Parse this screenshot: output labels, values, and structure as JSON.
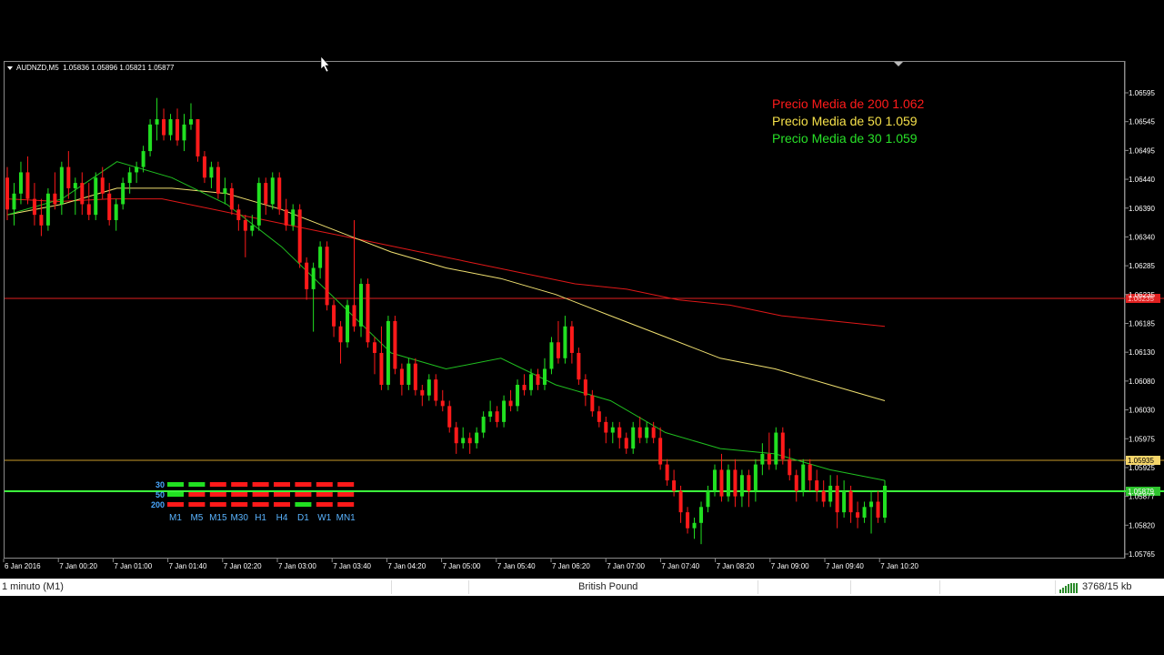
{
  "chart_header": {
    "symbol_timeframe": "AUDNZD,M5",
    "ohlc": "1.05836 1.05896 1.05821 1.05877"
  },
  "legend": {
    "ma200": "Precio Media de 200  1.062",
    "ma50": "Precio Media de 50  1.059",
    "ma30": "Precio Media de 30  1.059"
  },
  "price_axis": {
    "ticks": [
      "1.06595",
      "1.06545",
      "1.06495",
      "1.06440",
      "1.06390",
      "1.06340",
      "1.06285",
      "1.06235",
      "1.06185",
      "1.06130",
      "1.06080",
      "1.06030",
      "1.05975",
      "1.05925",
      "1.05877",
      "1.05820",
      "1.05765"
    ],
    "markers": {
      "red_line": "1.06235",
      "orange_line": "1.05935",
      "green_line": "1.05879"
    }
  },
  "time_axis": {
    "ticks": [
      "6 Jan 2016",
      "7 Jan 00:20",
      "7 Jan 01:00",
      "7 Jan 01:40",
      "7 Jan 02:20",
      "7 Jan 03:00",
      "7 Jan 03:40",
      "7 Jan 04:20",
      "7 Jan 05:00",
      "7 Jan 05:40",
      "7 Jan 06:20",
      "7 Jan 07:00",
      "7 Jan 07:40",
      "7 Jan 08:20",
      "7 Jan 09:00",
      "7 Jan 09:40",
      "7 Jan 10:20"
    ]
  },
  "mtf_indicator": {
    "rows": [
      {
        "label": "30",
        "states": [
          "up",
          "up",
          "down",
          "down",
          "down",
          "down",
          "down",
          "down",
          "down"
        ]
      },
      {
        "label": "50",
        "states": [
          "up",
          "down",
          "down",
          "down",
          "down",
          "down",
          "down",
          "down",
          "down"
        ]
      },
      {
        "label": "200",
        "states": [
          "down",
          "down",
          "down",
          "down",
          "down",
          "down",
          "up",
          "down",
          "down"
        ]
      }
    ],
    "timeframes": [
      "M1",
      "M5",
      "M15",
      "M30",
      "H1",
      "H4",
      "D1",
      "W1",
      "MN1"
    ]
  },
  "status_bar": {
    "timeframe": "1 minuto (M1)",
    "profile": "British Pound",
    "traffic": "3768/15 kb"
  },
  "colors": {
    "bull": "#21e021",
    "bear": "#ff1a1a",
    "ma200": "#e01818",
    "ma50": "#f0e070",
    "ma30": "#20c020",
    "price_line": "#3cff3c",
    "level_red": "#e02020",
    "level_orange": "#c89a2a"
  },
  "chart_data": {
    "type": "candlestick",
    "symbol": "AUDNZD",
    "timeframe": "M5",
    "ylim": [
      1.0575,
      1.0662
    ],
    "candles": [
      [
        1.0645,
        1.0647,
        1.0637,
        1.0639
      ],
      [
        1.0639,
        1.0644,
        1.0636,
        1.0642
      ],
      [
        1.0642,
        1.0648,
        1.064,
        1.0646
      ],
      [
        1.0646,
        1.0649,
        1.064,
        1.0641
      ],
      [
        1.0641,
        1.0644,
        1.0636,
        1.0638
      ],
      [
        1.0638,
        1.0641,
        1.0634,
        1.0636
      ],
      [
        1.0636,
        1.0643,
        1.0635,
        1.0642
      ],
      [
        1.0642,
        1.0646,
        1.0639,
        1.064
      ],
      [
        1.064,
        1.0648,
        1.0638,
        1.0647
      ],
      [
        1.0647,
        1.065,
        1.0641,
        1.0643
      ],
      [
        1.0643,
        1.0645,
        1.0638,
        1.0644
      ],
      [
        1.0644,
        1.0646,
        1.0638,
        1.064
      ],
      [
        1.064,
        1.0644,
        1.0637,
        1.0638
      ],
      [
        1.0638,
        1.0646,
        1.0637,
        1.0645
      ],
      [
        1.0645,
        1.0647,
        1.0641,
        1.0642
      ],
      [
        1.0642,
        1.0644,
        1.0636,
        1.0637
      ],
      [
        1.0637,
        1.0641,
        1.0635,
        1.064
      ],
      [
        1.064,
        1.0645,
        1.0639,
        1.0644
      ],
      [
        1.0644,
        1.0647,
        1.0642,
        1.0646
      ],
      [
        1.0646,
        1.0648,
        1.0644,
        1.0647
      ],
      [
        1.0647,
        1.0651,
        1.0646,
        1.065
      ],
      [
        1.065,
        1.0656,
        1.0649,
        1.0655
      ],
      [
        1.0655,
        1.066,
        1.0652,
        1.0656
      ],
      [
        1.0656,
        1.0658,
        1.0652,
        1.0653
      ],
      [
        1.0653,
        1.0657,
        1.0652,
        1.0656
      ],
      [
        1.0656,
        1.0658,
        1.0651,
        1.0652
      ],
      [
        1.0652,
        1.0657,
        1.065,
        1.0655
      ],
      [
        1.0655,
        1.0659,
        1.0654,
        1.0656
      ],
      [
        1.0656,
        1.0656,
        1.0648,
        1.0649
      ],
      [
        1.0649,
        1.065,
        1.0644,
        1.0645
      ],
      [
        1.0645,
        1.0648,
        1.0643,
        1.0647
      ],
      [
        1.0647,
        1.0648,
        1.0641,
        1.0642
      ],
      [
        1.0642,
        1.0645,
        1.064,
        1.0643
      ],
      [
        1.0643,
        1.0644,
        1.0638,
        1.0639
      ],
      [
        1.0639,
        1.064,
        1.0635,
        1.0637
      ],
      [
        1.0637,
        1.0638,
        1.063,
        1.0635
      ],
      [
        1.0635,
        1.0638,
        1.0634,
        1.0636
      ],
      [
        1.0636,
        1.0645,
        1.0635,
        1.0644
      ],
      [
        1.0644,
        1.0645,
        1.0638,
        1.064
      ],
      [
        1.064,
        1.0646,
        1.0639,
        1.0645
      ],
      [
        1.0645,
        1.0646,
        1.0638,
        1.0639
      ],
      [
        1.0639,
        1.0641,
        1.0635,
        1.0636
      ],
      [
        1.0636,
        1.064,
        1.0635,
        1.0639
      ],
      [
        1.0639,
        1.064,
        1.0628,
        1.0629
      ],
      [
        1.0629,
        1.063,
        1.0622,
        1.0624
      ],
      [
        1.0624,
        1.0629,
        1.0616,
        1.0628
      ],
      [
        1.0628,
        1.0633,
        1.0626,
        1.0632
      ],
      [
        1.0632,
        1.0633,
        1.062,
        1.0621
      ],
      [
        1.0621,
        1.0622,
        1.0615,
        1.0617
      ],
      [
        1.0617,
        1.0618,
        1.061,
        1.0614
      ],
      [
        1.0614,
        1.0622,
        1.0613,
        1.0621
      ],
      [
        1.0621,
        1.0637,
        1.0616,
        1.0617
      ],
      [
        1.0617,
        1.0626,
        1.0615,
        1.0625
      ],
      [
        1.0625,
        1.0626,
        1.0613,
        1.0614
      ],
      [
        1.0614,
        1.0615,
        1.0608,
        1.0612
      ],
      [
        1.0612,
        1.0617,
        1.0605,
        1.0606
      ],
      [
        1.0606,
        1.0619,
        1.0605,
        1.0618
      ],
      [
        1.0618,
        1.0619,
        1.0608,
        1.0609
      ],
      [
        1.0609,
        1.061,
        1.0604,
        1.0606
      ],
      [
        1.0606,
        1.0611,
        1.0605,
        1.061
      ],
      [
        1.061,
        1.0611,
        1.0604,
        1.0605
      ],
      [
        1.0605,
        1.0606,
        1.0602,
        1.0604
      ],
      [
        1.0604,
        1.0608,
        1.0603,
        1.0607
      ],
      [
        1.0607,
        1.0608,
        1.0602,
        1.0603
      ],
      [
        1.0603,
        1.0605,
        1.0601,
        1.0602
      ],
      [
        1.0602,
        1.0603,
        1.0597,
        1.0598
      ],
      [
        1.0598,
        1.0599,
        1.0593,
        1.0595
      ],
      [
        1.0595,
        1.0598,
        1.0594,
        1.0596
      ],
      [
        1.0596,
        1.0597,
        1.0593,
        1.0595
      ],
      [
        1.0595,
        1.0598,
        1.0594,
        1.0597
      ],
      [
        1.0597,
        1.0601,
        1.0596,
        1.06
      ],
      [
        1.06,
        1.0603,
        1.0599,
        1.0601
      ],
      [
        1.0601,
        1.0602,
        1.0598,
        1.0599
      ],
      [
        1.0599,
        1.0604,
        1.0598,
        1.0603
      ],
      [
        1.0603,
        1.0605,
        1.0601,
        1.0602
      ],
      [
        1.0602,
        1.0607,
        1.0601,
        1.0606
      ],
      [
        1.0606,
        1.0608,
        1.0604,
        1.0605
      ],
      [
        1.0605,
        1.0609,
        1.0604,
        1.0608
      ],
      [
        1.0608,
        1.0609,
        1.0605,
        1.0606
      ],
      [
        1.0606,
        1.0611,
        1.0605,
        1.0609
      ],
      [
        1.0609,
        1.0615,
        1.0608,
        1.0614
      ],
      [
        1.0614,
        1.0618,
        1.061,
        1.0611
      ],
      [
        1.0611,
        1.0619,
        1.061,
        1.0617
      ],
      [
        1.0617,
        1.0618,
        1.061,
        1.0612
      ],
      [
        1.0612,
        1.0613,
        1.0606,
        1.0607
      ],
      [
        1.0607,
        1.0608,
        1.0602,
        1.0604
      ],
      [
        1.0604,
        1.0605,
        1.06,
        1.0601
      ],
      [
        1.0601,
        1.0602,
        1.0598,
        1.0599
      ],
      [
        1.0599,
        1.06,
        1.0595,
        1.0597
      ],
      [
        1.0597,
        1.0599,
        1.0595,
        1.0598
      ],
      [
        1.0598,
        1.0599,
        1.0594,
        1.0596
      ],
      [
        1.0596,
        1.0597,
        1.0593,
        1.0594
      ],
      [
        1.0594,
        1.0599,
        1.0593,
        1.0598
      ],
      [
        1.0598,
        1.06,
        1.0595,
        1.0596
      ],
      [
        1.0596,
        1.0599,
        1.0595,
        1.0598
      ],
      [
        1.0598,
        1.0599,
        1.0595,
        1.0596
      ],
      [
        1.0596,
        1.0598,
        1.059,
        1.0591
      ],
      [
        1.0591,
        1.0592,
        1.0587,
        1.0588
      ],
      [
        1.0588,
        1.059,
        1.0585,
        1.0586
      ],
      [
        1.0586,
        1.0587,
        1.058,
        1.0582
      ],
      [
        1.0582,
        1.0583,
        1.0578,
        1.0579
      ],
      [
        1.0579,
        1.0581,
        1.0577,
        1.058
      ],
      [
        1.058,
        1.0584,
        1.0576,
        1.0583
      ],
      [
        1.0583,
        1.0587,
        1.0582,
        1.0586
      ],
      [
        1.0586,
        1.0591,
        1.0585,
        1.059
      ],
      [
        1.059,
        1.0593,
        1.0584,
        1.0585
      ],
      [
        1.0585,
        1.0591,
        1.0584,
        1.059
      ],
      [
        1.059,
        1.0592,
        1.0583,
        1.0585
      ],
      [
        1.0585,
        1.059,
        1.0583,
        1.0589
      ],
      [
        1.0589,
        1.059,
        1.0583,
        1.0586
      ],
      [
        1.0586,
        1.0592,
        1.0584,
        1.0591
      ],
      [
        1.0591,
        1.0595,
        1.0589,
        1.0593
      ],
      [
        1.0593,
        1.0597,
        1.059,
        1.0591
      ],
      [
        1.0591,
        1.0598,
        1.059,
        1.0597
      ],
      [
        1.0597,
        1.0598,
        1.0591,
        1.0592
      ],
      [
        1.0592,
        1.0594,
        1.0588,
        1.0589
      ],
      [
        1.0589,
        1.059,
        1.0584,
        1.0586
      ],
      [
        1.0586,
        1.0592,
        1.0585,
        1.0591
      ],
      [
        1.0591,
        1.0592,
        1.0586,
        1.0588
      ],
      [
        1.0588,
        1.059,
        1.0584,
        1.0586
      ],
      [
        1.0586,
        1.0588,
        1.0583,
        1.0584
      ],
      [
        1.0584,
        1.0589,
        1.0583,
        1.0587
      ],
      [
        1.0587,
        1.0589,
        1.0579,
        1.0582
      ],
      [
        1.0582,
        1.0588,
        1.0581,
        1.0586
      ],
      [
        1.0586,
        1.0587,
        1.058,
        1.0582
      ],
      [
        1.0582,
        1.0584,
        1.0579,
        1.0581
      ],
      [
        1.0581,
        1.0584,
        1.058,
        1.0583
      ],
      [
        1.0583,
        1.0586,
        1.0578,
        1.0584
      ],
      [
        1.0584,
        1.0586,
        1.058,
        1.0581
      ],
      [
        1.0581,
        1.0588,
        1.058,
        1.0587
      ]
    ],
    "ma200_points": [
      1.0641,
      1.06405,
      1.0641,
      1.0641,
      1.0639,
      1.0637,
      1.0635,
      1.0633,
      1.0631,
      1.0629,
      1.0627,
      1.0625,
      1.0624,
      1.0622,
      1.0621,
      1.0619,
      1.0618,
      1.0617
    ],
    "ma50_points": [
      1.0638,
      1.064,
      1.0643,
      1.0643,
      1.0642,
      1.0639,
      1.0635,
      1.0631,
      1.0628,
      1.0626,
      1.0623,
      1.0619,
      1.0615,
      1.0611,
      1.0609,
      1.0606,
      1.0603
    ],
    "ma30_points": [
      1.0638,
      1.0641,
      1.0648,
      1.0645,
      1.064,
      1.0632,
      1.0622,
      1.0612,
      1.0609,
      1.0611,
      1.0606,
      1.0603,
      1.0597,
      1.0594,
      1.0593,
      1.059,
      1.0588
    ]
  }
}
